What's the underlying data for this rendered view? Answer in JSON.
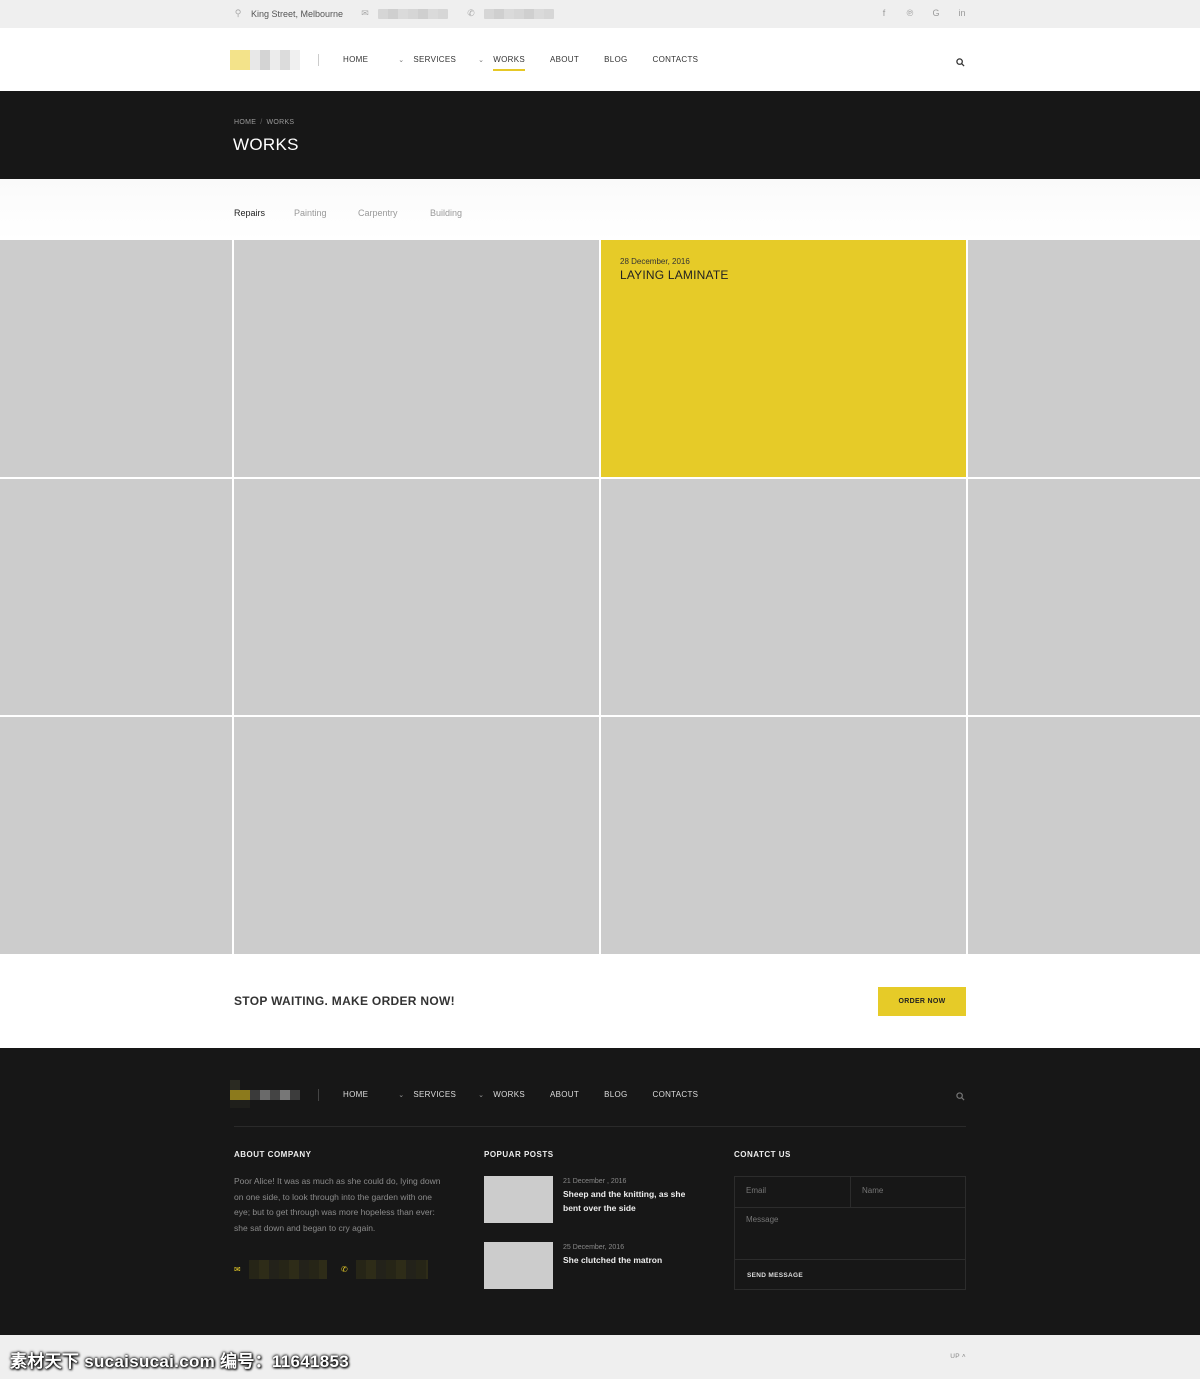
{
  "topbar": {
    "address": "King Street, Melbourne",
    "icons": {
      "location": "map-pin-icon",
      "mail": "mail-icon",
      "phone": "phone-icon"
    },
    "social": [
      "facebook-icon",
      "twitter-icon",
      "google-icon",
      "linkedin-icon"
    ]
  },
  "nav": {
    "items": [
      {
        "label": "HOME",
        "dropdown": false
      },
      {
        "label": "SERVICES",
        "dropdown": true
      },
      {
        "label": "WORKS",
        "dropdown": true
      },
      {
        "label": "ABOUT",
        "dropdown": false
      },
      {
        "label": "BLOG",
        "dropdown": false
      },
      {
        "label": "CONTACTS",
        "dropdown": false
      }
    ],
    "active": "WORKS",
    "accent": "#e6cb28"
  },
  "page": {
    "breadcrumb": [
      "HOME",
      "WORKS"
    ],
    "title": "WORKS"
  },
  "filters": [
    {
      "label": "Repairs",
      "active": true
    },
    {
      "label": "Painting",
      "active": false
    },
    {
      "label": "Carpentry",
      "active": false
    },
    {
      "label": "Building",
      "active": false
    }
  ],
  "works": {
    "featured": {
      "date": "28 December, 2016",
      "title": "LAYING LAMINATE"
    }
  },
  "cta": {
    "message": "STOP WAITING. MAKE ORDER NOW!",
    "button": "ORDER NOW"
  },
  "footer": {
    "about_title": "ABOUT COMPANY",
    "about_text": "Poor Alice! It was as much as she could do, lying down on one side, to look through into the garden with one eye; but to get through was more hopeless than ever: she sat down and began to cry again.",
    "posts_title": "POPUAR POSTS",
    "posts": [
      {
        "date": "21 December , 2016",
        "title": "Sheep and the knitting, as she bent over the side"
      },
      {
        "date": "25 December, 2016",
        "title": "She clutched the matron"
      }
    ],
    "contact_title": "CONATCT US",
    "form": {
      "email": "Email",
      "name": "Name",
      "message": "Message",
      "send": "SEND MESSAGE"
    }
  },
  "bottom": {
    "up": "UP"
  },
  "watermark": "素材天下 sucaisucai.com  编号：11641853"
}
